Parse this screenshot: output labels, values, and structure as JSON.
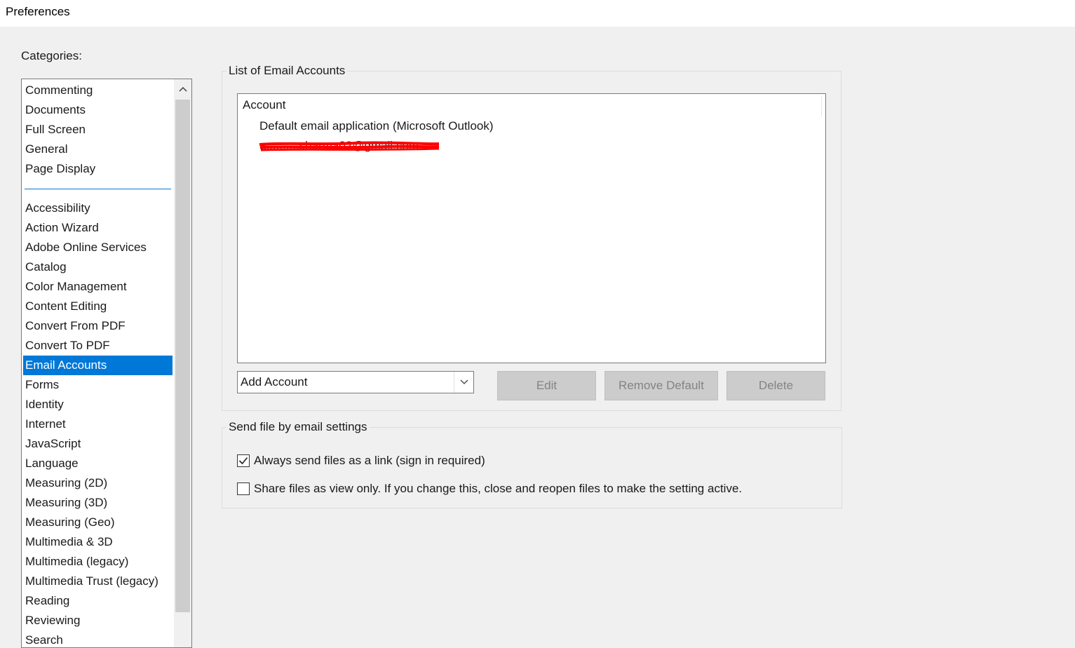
{
  "window": {
    "title": "Preferences"
  },
  "categories": {
    "label": "Categories:",
    "top_items": [
      "Commenting",
      "Documents",
      "Full Screen",
      "General",
      "Page Display"
    ],
    "items": [
      "Accessibility",
      "Action Wizard",
      "Adobe Online Services",
      "Catalog",
      "Color Management",
      "Content Editing",
      "Convert From PDF",
      "Convert To PDF",
      "Email Accounts",
      "Forms",
      "Identity",
      "Internet",
      "JavaScript",
      "Language",
      "Measuring (2D)",
      "Measuring (3D)",
      "Measuring (Geo)",
      "Multimedia & 3D",
      "Multimedia (legacy)",
      "Multimedia Trust (legacy)",
      "Reading",
      "Reviewing",
      "Search"
    ],
    "selected": "Email Accounts"
  },
  "email_accounts": {
    "legend": "List of Email Accounts",
    "column_header": "Account",
    "rows": [
      "Default email application (Microsoft Outlook)",
      "a..........sharma02@gmail.com"
    ],
    "add_account_value": "Add Account",
    "edit_label": "Edit",
    "remove_default_label": "Remove Default",
    "delete_label": "Delete"
  },
  "send_settings": {
    "legend": "Send file by email settings",
    "option_link": {
      "label": "Always send files as a link (sign in required)",
      "checked": true
    },
    "option_view_only": {
      "label": "Share files as view only. If you change this, close and reopen files to make the setting active.",
      "checked": false
    }
  },
  "colors": {
    "selection": "#0078d7",
    "redaction": "#ff0000"
  }
}
